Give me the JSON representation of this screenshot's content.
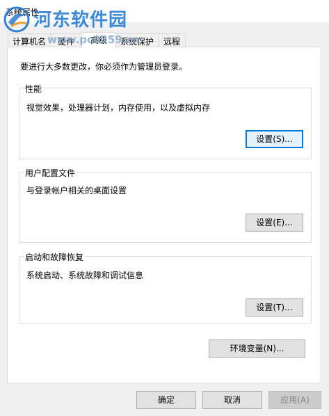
{
  "window": {
    "title": "系统属性"
  },
  "watermark": {
    "brand": "河东软件园",
    "url": "www.pc0359.cn"
  },
  "tabs": [
    {
      "label": "计算机名",
      "active": false
    },
    {
      "label": "硬件",
      "active": false
    },
    {
      "label": "高级",
      "active": true
    },
    {
      "label": "系统保护",
      "active": false
    },
    {
      "label": "远程",
      "active": false
    }
  ],
  "advanced": {
    "admin_note": "要进行大多数更改，你必须作为管理员登录。",
    "performance": {
      "title": "性能",
      "description": "视觉效果，处理器计划，内存使用，以及虚拟内存",
      "button": "设置(S)..."
    },
    "user_profiles": {
      "title": "用户配置文件",
      "description": "与登录帐户相关的桌面设置",
      "button": "设置(E)..."
    },
    "startup_recovery": {
      "title": "启动和故障恢复",
      "description": "系统启动、系统故障和调试信息",
      "button": "设置(T)..."
    },
    "env_button": "环境变量(N)..."
  },
  "footer": {
    "ok": "确定",
    "cancel": "取消",
    "apply": "应用(A)"
  },
  "colors": {
    "focus_border": "#0078d7",
    "watermark_blue": "#2d7fd3"
  }
}
